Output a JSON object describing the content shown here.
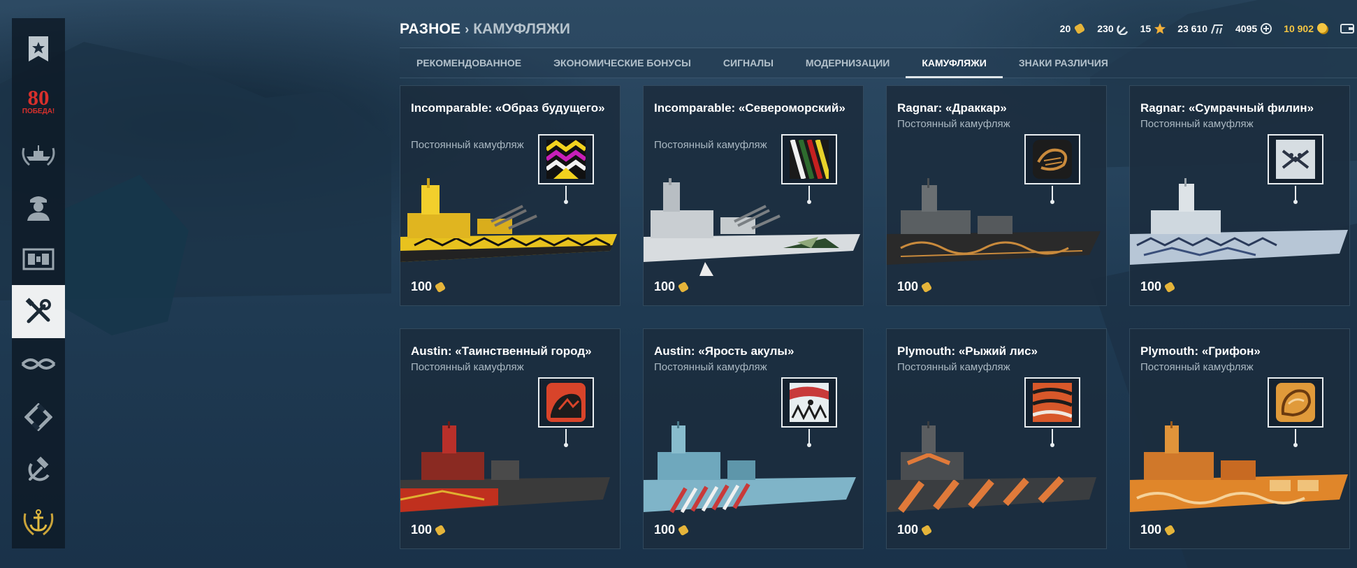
{
  "sidebar": {
    "items": [
      {
        "name": "rank-flag-icon"
      },
      {
        "name": "victory-80-icon",
        "label_top": "80",
        "label_bottom": "ПОБЕДА!"
      },
      {
        "name": "fleet-laurel-icon"
      },
      {
        "name": "captain-icon"
      },
      {
        "name": "armory-icon"
      },
      {
        "name": "tools-icon",
        "active": true
      },
      {
        "name": "rope-knot-icon"
      },
      {
        "name": "diamond-arrow-icon"
      },
      {
        "name": "hammer-sickle-icon"
      },
      {
        "name": "anchor-laurel-icon"
      }
    ]
  },
  "header": {
    "root": "РАЗНОЕ",
    "separator": "›",
    "current": "КАМУФЛЯЖИ"
  },
  "resources": [
    {
      "value": "20",
      "icon": "camo-token-icon"
    },
    {
      "value": "230",
      "icon": "hammer-sickle-token-icon"
    },
    {
      "value": "15",
      "icon": "star-icon"
    },
    {
      "value": "23 610",
      "icon": "free-xp-icon"
    },
    {
      "value": "4095",
      "icon": "elite-xp-icon"
    },
    {
      "value": "10 902",
      "icon": "gold-coin-icon",
      "gold": true
    },
    {
      "value": "",
      "icon": "wallet-icon"
    }
  ],
  "tabs": [
    {
      "label": "РЕКОМЕНДОВАННОЕ"
    },
    {
      "label": "ЭКОНОМИЧЕСКИЕ БОНУСЫ"
    },
    {
      "label": "СИГНАЛЫ"
    },
    {
      "label": "МОДЕРНИЗАЦИИ"
    },
    {
      "label": "КАМУФЛЯЖИ",
      "active": true
    },
    {
      "label": "ЗНАКИ РАЗЛИЧИЯ"
    }
  ],
  "cards": [
    {
      "title": "Incomparable: «Образ будущего»",
      "subtitle": "Постоянный камуфляж",
      "price": "100",
      "lines": 2
    },
    {
      "title": "Incomparable: «Североморский»",
      "subtitle": "Постоянный камуфляж",
      "price": "100",
      "lines": 2
    },
    {
      "title": "Ragnar: «Драккар»",
      "subtitle": "Постоянный камуфляж",
      "price": "100",
      "lines": 1
    },
    {
      "title": "Ragnar: «Сумрачный филин»",
      "subtitle": "Постоянный камуфляж",
      "price": "100",
      "lines": 1
    },
    {
      "title": "Austin: «Таинственный город»",
      "subtitle": "Постоянный камуфляж",
      "price": "100",
      "lines": 1
    },
    {
      "title": "Austin: «Ярость акулы»",
      "subtitle": "Постоянный камуфляж",
      "price": "100",
      "lines": 1
    },
    {
      "title": "Plymouth: «Рыжий лис»",
      "subtitle": "Постоянный камуфляж",
      "price": "100",
      "lines": 1
    },
    {
      "title": "Plymouth: «Грифон»",
      "subtitle": "Постоянный камуфляж",
      "price": "100",
      "lines": 1
    }
  ],
  "colors": {
    "accent_gold": "#f4c542",
    "active_tab_underline": "#dfe6ea",
    "card_bg": "#1b2c3d"
  }
}
